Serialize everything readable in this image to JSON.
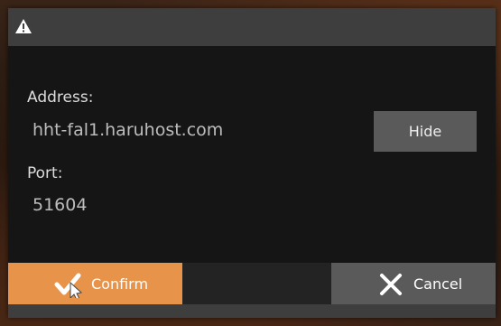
{
  "dialog": {
    "title_icon": "warning-icon",
    "address_label": "Address:",
    "address_value": "hht-fal1.haruhost.com",
    "port_label": "Port:",
    "port_value": "51604",
    "hide_label": "Hide",
    "confirm_label": "Confirm",
    "confirm_icon": "check-icon",
    "cancel_label": "Cancel",
    "cancel_icon": "close-icon"
  },
  "colors": {
    "accent": "#e8934a",
    "button_gray": "#5a5a5a",
    "titlebar": "#3e3e3e",
    "panel": "#161515"
  }
}
